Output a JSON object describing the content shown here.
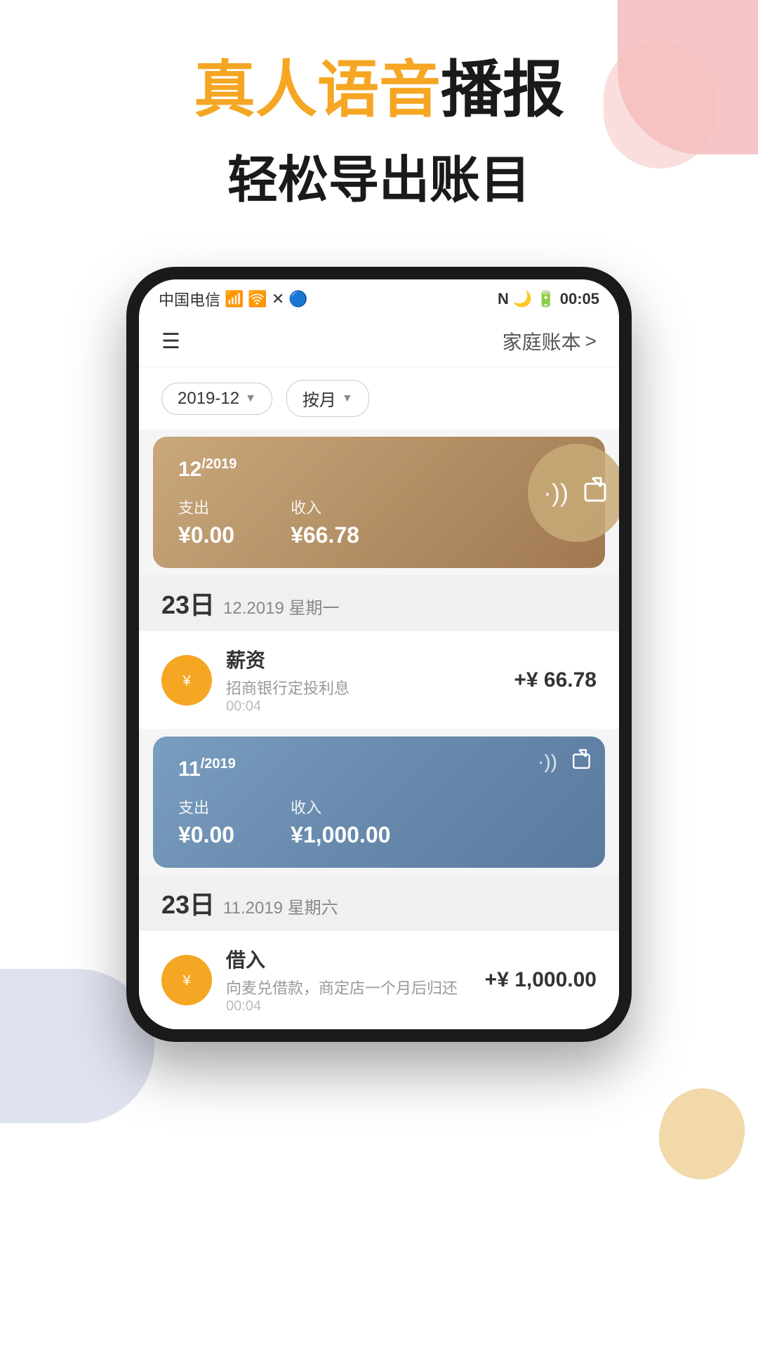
{
  "background": {
    "decoColors": [
      "#f0a0a0",
      "#f5bebe",
      "#b0b8d8",
      "#e8c070"
    ]
  },
  "header": {
    "title_part1": "真人语音",
    "title_part2": "播报",
    "subtitle": "轻松导出账目"
  },
  "statusBar": {
    "carrier": "中国电信",
    "signal": "46",
    "wifi": "WiFi",
    "nfc": "NFC",
    "battery": "46",
    "time": "00:05"
  },
  "appHeader": {
    "bookName": "家庭账本",
    "chevron": ">"
  },
  "filters": {
    "dateFilter": "2019-12",
    "dateArrow": "▼",
    "periodFilter": "按月",
    "periodArrow": "▼"
  },
  "monthCards": [
    {
      "month": "12",
      "year": "2019",
      "expenseLabel": "支出",
      "expenseAmount": "¥0.00",
      "incomeLabel": "收入",
      "incomeAmount": "¥66.78",
      "style": "gold"
    },
    {
      "month": "11",
      "year": "2019",
      "expenseLabel": "支出",
      "expenseAmount": "¥0.00",
      "incomeLabel": "收入",
      "incomeAmount": "¥1,000.00",
      "style": "blue"
    }
  ],
  "dateSeparators": [
    {
      "day": "23日",
      "detail": "12.2019 星期一"
    },
    {
      "day": "23日",
      "detail": "11.2019 星期六"
    }
  ],
  "transactions": [
    {
      "icon": "💰",
      "name": "薪资",
      "sub": "招商银行定投利息",
      "time": "00:04",
      "amount": "+¥ 66.78"
    },
    {
      "icon": "💰",
      "name": "借入",
      "sub": "向麦兑借款，商定店一个月后归还",
      "time": "00:04",
      "amount": "+¥ 1,000.00"
    }
  ],
  "icons": {
    "sound": "·))",
    "export": "↗",
    "menu": "☰"
  }
}
